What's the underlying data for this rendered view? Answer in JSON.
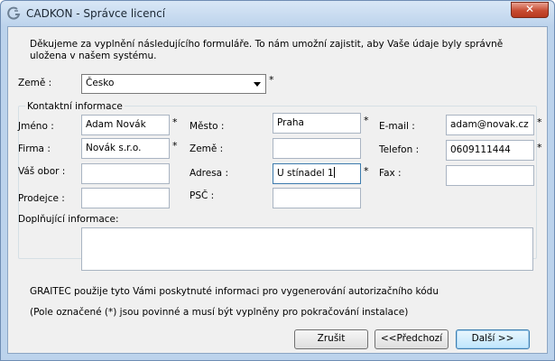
{
  "window": {
    "title": "CADKON - Správce licencí",
    "close_glyph": "✕"
  },
  "intro": "Děkujeme za vyplnění následujícího formuláře. To nám umožní zajistit, aby Vaše údaje byly správně uložena v našem systému.",
  "required_mark": "*",
  "country": {
    "label": "Země :",
    "value": "Česko"
  },
  "contact_group": {
    "legend": "Kontaktní informace"
  },
  "fields": {
    "name": {
      "label": "Jméno :",
      "value": "Adam Novák"
    },
    "company": {
      "label": "Firma :",
      "value": "Novák s.r.o."
    },
    "field_of_work": {
      "label": "Váš obor :",
      "value": ""
    },
    "seller": {
      "label": "Prodejce :",
      "value": ""
    },
    "city": {
      "label": "Město :",
      "value": "Praha"
    },
    "country2": {
      "label": "Země :",
      "value": ""
    },
    "address": {
      "label": "Adresa :",
      "value": "U stínadel 1"
    },
    "zip": {
      "label": "PSČ :",
      "value": ""
    },
    "email": {
      "label": "E-mail :",
      "value": "adam@novak.cz"
    },
    "phone": {
      "label": "Telefon :",
      "value": "0609111444"
    },
    "fax": {
      "label": "Fax :",
      "value": ""
    }
  },
  "additional": {
    "label": "Doplňující informace:",
    "value": ""
  },
  "notice1": "GRAITEC použije tyto Vámi poskytnuté informaci pro vygenerování autorizačního kódu",
  "notice2": "(Pole označené (*) jsou povinné a musí být vyplněny pro pokračování instalace)",
  "buttons": {
    "cancel": "Zrušit",
    "back": "<<Předchozí",
    "next": "Další >>"
  },
  "icons": {
    "app": "cadkon-app-icon",
    "close": "close-icon",
    "dropdown": "chevron-down-icon"
  },
  "colors": {
    "titlebar": "#bcd3ec",
    "close": "#c74c32",
    "client": "#f0f0f0"
  }
}
